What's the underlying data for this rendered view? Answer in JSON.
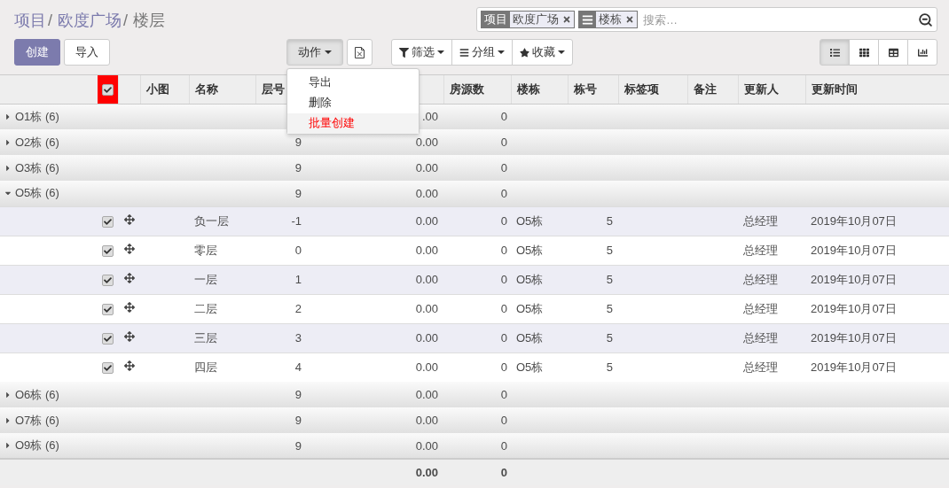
{
  "breadcrumbs": [
    {
      "label": "项目",
      "link": true,
      "separator": "/"
    },
    {
      "label": "欧度广场",
      "link": true,
      "separator": "/"
    },
    {
      "label": "楼层",
      "link": false
    }
  ],
  "search": {
    "facets": [
      {
        "kind": "field",
        "label": "项目",
        "value": "欧度广场"
      },
      {
        "kind": "groupby",
        "value": "楼栋"
      }
    ],
    "placeholder": "搜索…"
  },
  "buttons": {
    "create": "创建",
    "import": "导入"
  },
  "action": {
    "label": "动作",
    "open": true,
    "menu": [
      {
        "label": "导出",
        "selected": false
      },
      {
        "label": "删除",
        "selected": false
      },
      {
        "label": "批量创建",
        "selected": true
      }
    ]
  },
  "search_options": [
    {
      "kind": "filter",
      "label": "筛选"
    },
    {
      "kind": "groupby",
      "label": "分组"
    },
    {
      "kind": "favorites",
      "label": "收藏"
    }
  ],
  "views": [
    {
      "kind": "list",
      "selected": true
    },
    {
      "kind": "kanban",
      "selected": false
    },
    {
      "kind": "grid",
      "selected": false
    },
    {
      "kind": "graph",
      "selected": false
    }
  ],
  "table": {
    "select_all": true,
    "columns": [
      "小图",
      "名称",
      "层号",
      "房源数",
      "楼栋",
      "栋号",
      "标签项",
      "备注",
      "更新人",
      "更新时间"
    ],
    "groups": [
      {
        "label": "O1栋 (6)",
        "expanded": false,
        "area": ".00",
        "rooms": "0"
      },
      {
        "label": "O2栋 (6)",
        "expanded": false,
        "floor": "9",
        "area": "0.00",
        "rooms": "0"
      },
      {
        "label": "O3栋 (6)",
        "expanded": false,
        "floor": "9",
        "area": "0.00",
        "rooms": "0"
      },
      {
        "label": "O5栋 (6)",
        "expanded": true,
        "floor": "9",
        "area": "0.00",
        "rooms": "0",
        "records": [
          {
            "checked": true,
            "name": "负一层",
            "floor": "-1",
            "area": "0.00",
            "rooms": "0",
            "building": "O5栋",
            "number": "5",
            "updater": "总经理",
            "updated": "2019年10月07日"
          },
          {
            "checked": true,
            "name": "零层",
            "floor": "0",
            "area": "0.00",
            "rooms": "0",
            "building": "O5栋",
            "number": "5",
            "updater": "总经理",
            "updated": "2019年10月07日"
          },
          {
            "checked": true,
            "name": "一层",
            "floor": "1",
            "area": "0.00",
            "rooms": "0",
            "building": "O5栋",
            "number": "5",
            "updater": "总经理",
            "updated": "2019年10月07日"
          },
          {
            "checked": true,
            "name": "二层",
            "floor": "2",
            "area": "0.00",
            "rooms": "0",
            "building": "O5栋",
            "number": "5",
            "updater": "总经理",
            "updated": "2019年10月07日"
          },
          {
            "checked": true,
            "name": "三层",
            "floor": "3",
            "area": "0.00",
            "rooms": "0",
            "building": "O5栋",
            "number": "5",
            "updater": "总经理",
            "updated": "2019年10月07日"
          },
          {
            "checked": true,
            "name": "四层",
            "floor": "4",
            "area": "0.00",
            "rooms": "0",
            "building": "O5栋",
            "number": "5",
            "updater": "总经理",
            "updated": "2019年10月07日"
          }
        ]
      },
      {
        "label": "O6栋 (6)",
        "expanded": false,
        "floor": "9",
        "area": "0.00",
        "rooms": "0"
      },
      {
        "label": "O7栋 (6)",
        "expanded": false,
        "floor": "9",
        "area": "0.00",
        "rooms": "0"
      },
      {
        "label": "O9栋 (6)",
        "expanded": false,
        "floor": "9",
        "area": "0.00",
        "rooms": "0"
      }
    ],
    "footer": {
      "area": "0.00",
      "rooms": "0"
    }
  }
}
